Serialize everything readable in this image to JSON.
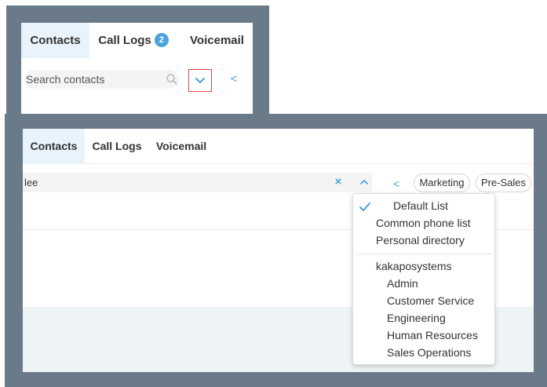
{
  "panel_small": {
    "tabs": [
      {
        "label": "Contacts",
        "active": true
      },
      {
        "label": "Call Logs",
        "badge": "2",
        "active": false
      },
      {
        "label": "Voicemail",
        "active": false
      }
    ],
    "search": {
      "placeholder": "Search contacts",
      "value": ""
    },
    "icons": {
      "search": "magnifier-icon",
      "dropdown": "chevron-down-icon",
      "back": "chevron-left-icon"
    }
  },
  "panel_large": {
    "tabs": [
      {
        "label": "Contacts",
        "active": true
      },
      {
        "label": "Call Logs",
        "active": false
      },
      {
        "label": "Voicemail",
        "active": false
      }
    ],
    "search": {
      "value": "lee",
      "placeholder": ""
    },
    "icons": {
      "clear": "close-icon",
      "dropdown": "chevron-up-icon",
      "back": "chevron-left-icon"
    },
    "clear_glyph": "×",
    "back_glyph": "<",
    "filter_chips": [
      "Marketing",
      "Pre-Sales"
    ],
    "directory_menu": {
      "selected": "Default List",
      "items": [
        "Default List",
        "Common phone list",
        "Personal directory"
      ],
      "group_title": "kakaposystems",
      "group_items": [
        "Admin",
        "Customer Service",
        "Engineering",
        "Human Resources",
        "Sales Operations"
      ]
    }
  },
  "colors": {
    "accent": "#4aa3e0",
    "active_tab_bg": "#e8f3fb",
    "frame": "#6b7a88",
    "highlight_border": "#e04848"
  }
}
